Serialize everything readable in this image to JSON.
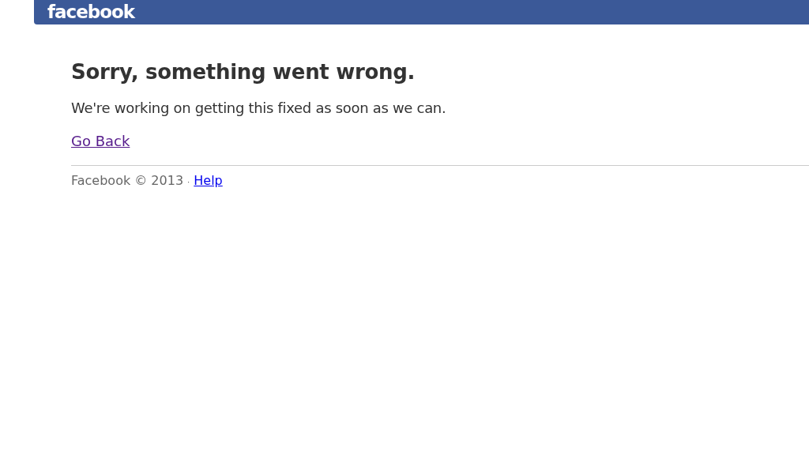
{
  "header": {
    "logo": "facebook"
  },
  "error": {
    "title": "Sorry, something went wrong.",
    "message": "We're working on getting this fixed as soon as we can.",
    "link": "Go Back"
  },
  "footer": {
    "copyright": "Facebook © 2013",
    "separator": "·",
    "link": "Help"
  }
}
